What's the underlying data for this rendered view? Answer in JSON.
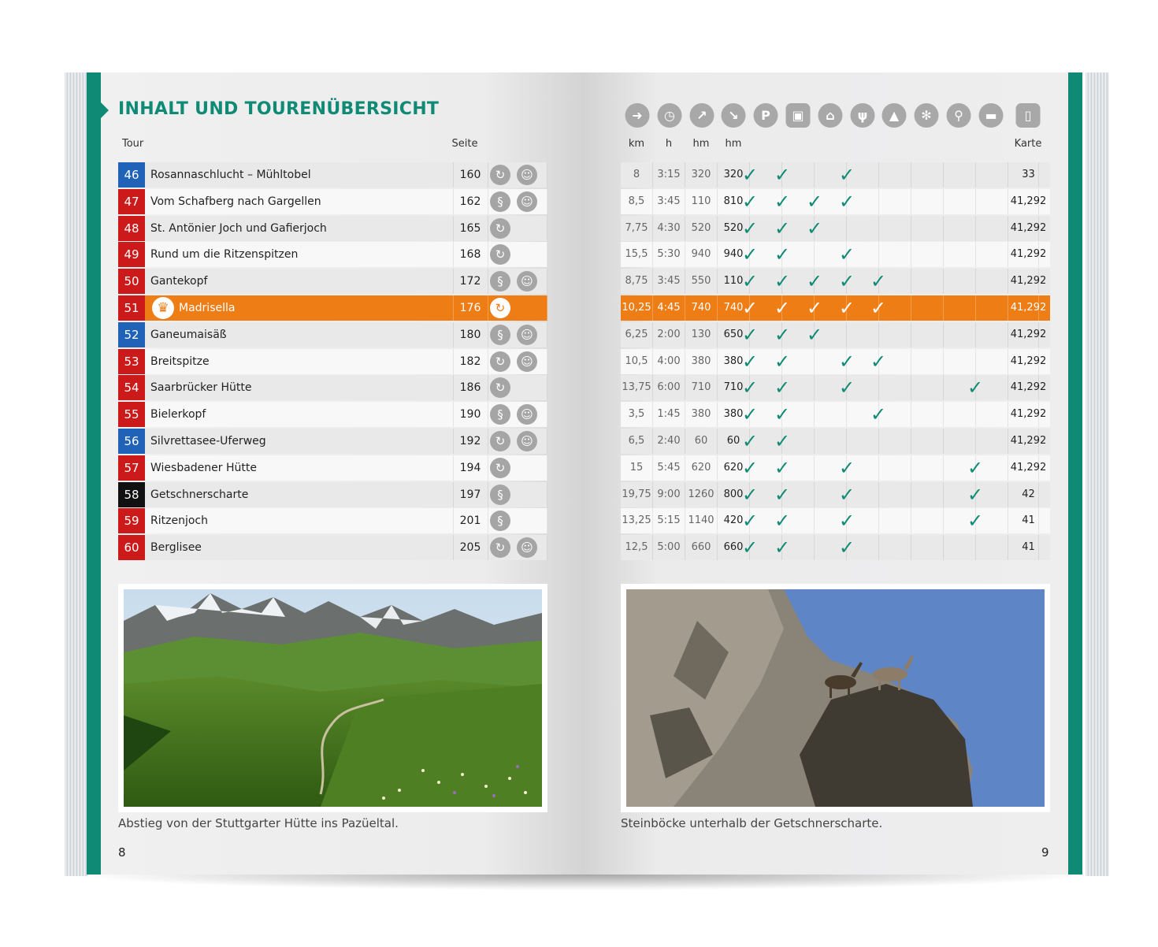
{
  "title": "INHALT UND TOURENÜBERSICHT",
  "headers": {
    "tour": "Tour",
    "seite": "Seite",
    "km": "km",
    "h": "h",
    "hm_up": "hm",
    "hm_down": "hm",
    "karte": "Karte"
  },
  "icons": [
    {
      "name": "signpost-icon",
      "glyph": "➜"
    },
    {
      "name": "clock-icon",
      "glyph": "◷"
    },
    {
      "name": "ascent-arrow-icon",
      "glyph": "↗"
    },
    {
      "name": "descent-arrow-icon",
      "glyph": "↘"
    },
    {
      "name": "parking-icon",
      "glyph": "P"
    },
    {
      "name": "bus-icon",
      "glyph": "▣"
    },
    {
      "name": "cable-car-icon",
      "glyph": "⌂"
    },
    {
      "name": "restaurant-icon",
      "glyph": "ψ"
    },
    {
      "name": "summit-icon",
      "glyph": "▲"
    },
    {
      "name": "winter-icon",
      "glyph": "✻"
    },
    {
      "name": "bike-icon",
      "glyph": "⚲"
    },
    {
      "name": "hut-bed-icon",
      "glyph": "▬"
    },
    {
      "name": "map-icon",
      "glyph": "▯"
    }
  ],
  "tours": [
    {
      "no": "46",
      "color": "#1f62b8",
      "name": "Rosannaschlucht – Mühltobel",
      "seite": "160",
      "sym1": "circle",
      "sym2": "child",
      "km": "8",
      "h": "3:15",
      "up": "320",
      "down": "320",
      "checks": [
        1,
        1,
        0,
        1,
        0,
        0,
        0,
        0
      ],
      "karte": "33"
    },
    {
      "no": "47",
      "color": "#cc1a1a",
      "name": "Vom Schafberg nach Gargellen",
      "seite": "162",
      "sym1": "path",
      "sym2": "child",
      "km": "8,5",
      "h": "3:45",
      "up": "110",
      "down": "810",
      "checks": [
        1,
        1,
        1,
        1,
        0,
        0,
        0,
        0
      ],
      "karte": "41,292"
    },
    {
      "no": "48",
      "color": "#cc1a1a",
      "name": "St. Antönier Joch und Gafierjoch",
      "seite": "165",
      "sym1": "circle",
      "sym2": "",
      "km": "7,75",
      "h": "4:30",
      "up": "520",
      "down": "520",
      "checks": [
        1,
        1,
        1,
        0,
        0,
        0,
        0,
        0
      ],
      "karte": "41,292"
    },
    {
      "no": "49",
      "color": "#cc1a1a",
      "name": "Rund um die Ritzenspitzen",
      "seite": "168",
      "sym1": "circle",
      "sym2": "",
      "km": "15,5",
      "h": "5:30",
      "up": "940",
      "down": "940",
      "checks": [
        1,
        1,
        0,
        1,
        0,
        0,
        0,
        0
      ],
      "karte": "41,292"
    },
    {
      "no": "50",
      "color": "#cc1a1a",
      "name": "Gantekopf",
      "seite": "172",
      "sym1": "path",
      "sym2": "child",
      "km": "8,75",
      "h": "3:45",
      "up": "550",
      "down": "110",
      "checks": [
        1,
        1,
        1,
        1,
        1,
        0,
        0,
        0
      ],
      "karte": "41,292"
    },
    {
      "no": "51",
      "color": "#cc1a1a",
      "name": "Madrisella",
      "seite": "176",
      "sym1": "circle",
      "sym2": "",
      "km": "10,25",
      "h": "4:45",
      "up": "740",
      "down": "740",
      "checks": [
        1,
        1,
        1,
        1,
        1,
        0,
        0,
        0
      ],
      "karte": "41,292",
      "highlight": true
    },
    {
      "no": "52",
      "color": "#1f62b8",
      "name": "Ganeumaisäß",
      "seite": "180",
      "sym1": "path",
      "sym2": "child",
      "km": "6,25",
      "h": "2:00",
      "up": "130",
      "down": "650",
      "checks": [
        1,
        1,
        1,
        0,
        0,
        0,
        0,
        0
      ],
      "karte": "41,292"
    },
    {
      "no": "53",
      "color": "#cc1a1a",
      "name": "Breitspitze",
      "seite": "182",
      "sym1": "circle",
      "sym2": "child",
      "km": "10,5",
      "h": "4:00",
      "up": "380",
      "down": "380",
      "checks": [
        1,
        1,
        0,
        1,
        1,
        0,
        0,
        0
      ],
      "karte": "41,292"
    },
    {
      "no": "54",
      "color": "#cc1a1a",
      "name": "Saarbrücker Hütte",
      "seite": "186",
      "sym1": "circle",
      "sym2": "",
      "km": "13,75",
      "h": "6:00",
      "up": "710",
      "down": "710",
      "checks": [
        1,
        1,
        0,
        1,
        0,
        0,
        0,
        1
      ],
      "karte": "41,292"
    },
    {
      "no": "55",
      "color": "#cc1a1a",
      "name": "Bielerkopf",
      "seite": "190",
      "sym1": "path",
      "sym2": "child",
      "km": "3,5",
      "h": "1:45",
      "up": "380",
      "down": "380",
      "checks": [
        1,
        1,
        0,
        0,
        1,
        0,
        0,
        0
      ],
      "karte": "41,292"
    },
    {
      "no": "56",
      "color": "#1f62b8",
      "name": "Silvrettasee-Uferweg",
      "seite": "192",
      "sym1": "circle",
      "sym2": "child",
      "km": "6,5",
      "h": "2:40",
      "up": "60",
      "down": "60",
      "checks": [
        1,
        1,
        0,
        0,
        0,
        0,
        0,
        0
      ],
      "karte": "41,292"
    },
    {
      "no": "57",
      "color": "#cc1a1a",
      "name": "Wiesbadener Hütte",
      "seite": "194",
      "sym1": "circle",
      "sym2": "",
      "km": "15",
      "h": "5:45",
      "up": "620",
      "down": "620",
      "checks": [
        1,
        1,
        0,
        1,
        0,
        0,
        0,
        1
      ],
      "karte": "41,292"
    },
    {
      "no": "58",
      "color": "#111111",
      "name": "Getschnerscharte",
      "seite": "197",
      "sym1": "path",
      "sym2": "",
      "km": "19,75",
      "h": "9:00",
      "up": "1260",
      "down": "800",
      "checks": [
        1,
        1,
        0,
        1,
        0,
        0,
        0,
        1
      ],
      "karte": "42"
    },
    {
      "no": "59",
      "color": "#cc1a1a",
      "name": "Ritzenjoch",
      "seite": "201",
      "sym1": "path",
      "sym2": "",
      "km": "13,25",
      "h": "5:15",
      "up": "1140",
      "down": "420",
      "checks": [
        1,
        1,
        0,
        1,
        0,
        0,
        0,
        1
      ],
      "karte": "41"
    },
    {
      "no": "60",
      "color": "#cc1a1a",
      "name": "Berglisee",
      "seite": "205",
      "sym1": "circle",
      "sym2": "child",
      "km": "12,5",
      "h": "5:00",
      "up": "660",
      "down": "660",
      "checks": [
        1,
        1,
        0,
        1,
        0,
        0,
        0,
        0
      ],
      "karte": "41"
    }
  ],
  "captions": {
    "left": "Abstieg von der Stuttgarter Hütte ins Pazüeltal.",
    "right": "Steinböcke unterhalb der Getschnerscharte."
  },
  "page_numbers": {
    "left": "8",
    "right": "9"
  },
  "colors": {
    "teal": "#0f8a74",
    "highlight": "#ef7d15",
    "red": "#cc1a1a",
    "blue": "#1f62b8"
  }
}
